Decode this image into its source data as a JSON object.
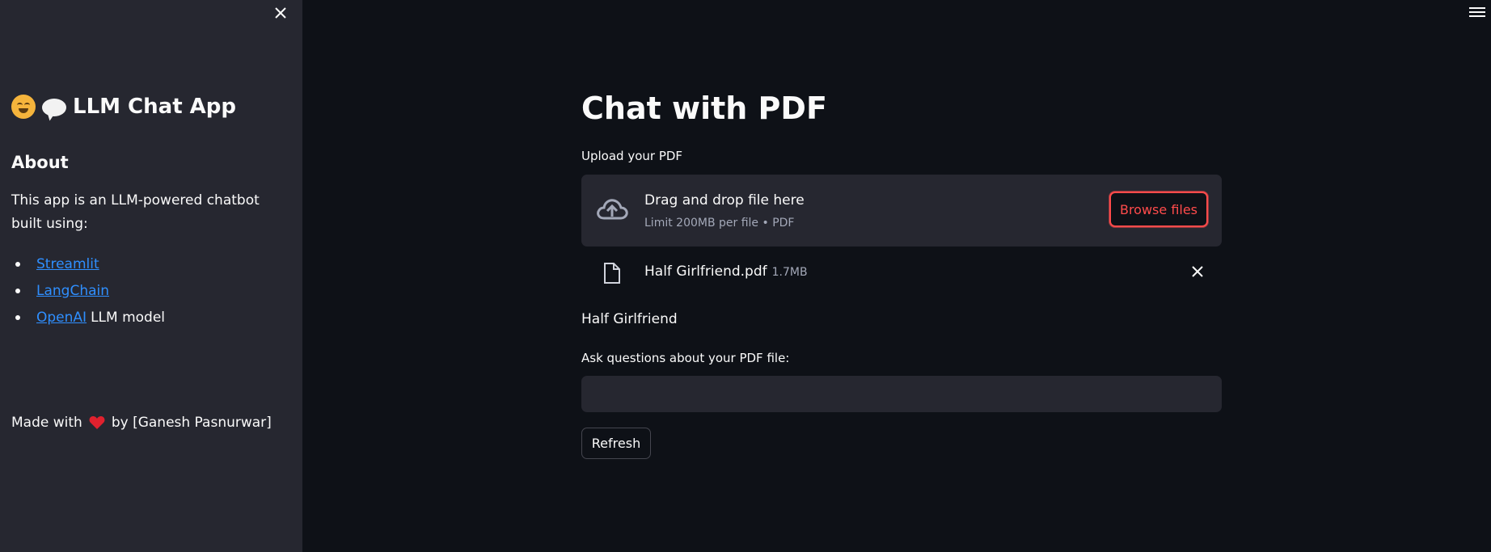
{
  "sidebar": {
    "title": "LLM Chat App",
    "about_heading": "About",
    "description": "This app is an LLM-powered chatbot built using:",
    "links": [
      {
        "label": "Streamlit",
        "suffix": ""
      },
      {
        "label": "LangChain",
        "suffix": ""
      },
      {
        "label": "OpenAI",
        "suffix": "LLM model"
      }
    ],
    "made_with_prefix": "Made with",
    "made_with_suffix": "by [Ganesh Pasnurwar]"
  },
  "main": {
    "page_title": "Chat with PDF",
    "uploader": {
      "label": "Upload your PDF",
      "dropzone_text": "Drag and drop file here",
      "dropzone_limit": "Limit 200MB per file • PDF",
      "browse_label": "Browse files"
    },
    "uploaded_file": {
      "name": "Half Girlfriend.pdf",
      "size": "1.7MB"
    },
    "file_title": "Half Girlfriend",
    "question": {
      "label": "Ask questions about your PDF file:",
      "value": ""
    },
    "refresh_label": "Refresh"
  },
  "colors": {
    "background": "#0e1117",
    "sidebar": "#262730",
    "accent": "#ff4b4b",
    "link": "#2f8fff"
  },
  "icons": [
    "close-icon",
    "hugging-face-icon",
    "speech-bubble-icon",
    "heart-icon",
    "menu-icon",
    "cloud-upload-icon",
    "file-icon",
    "remove-file-icon"
  ]
}
